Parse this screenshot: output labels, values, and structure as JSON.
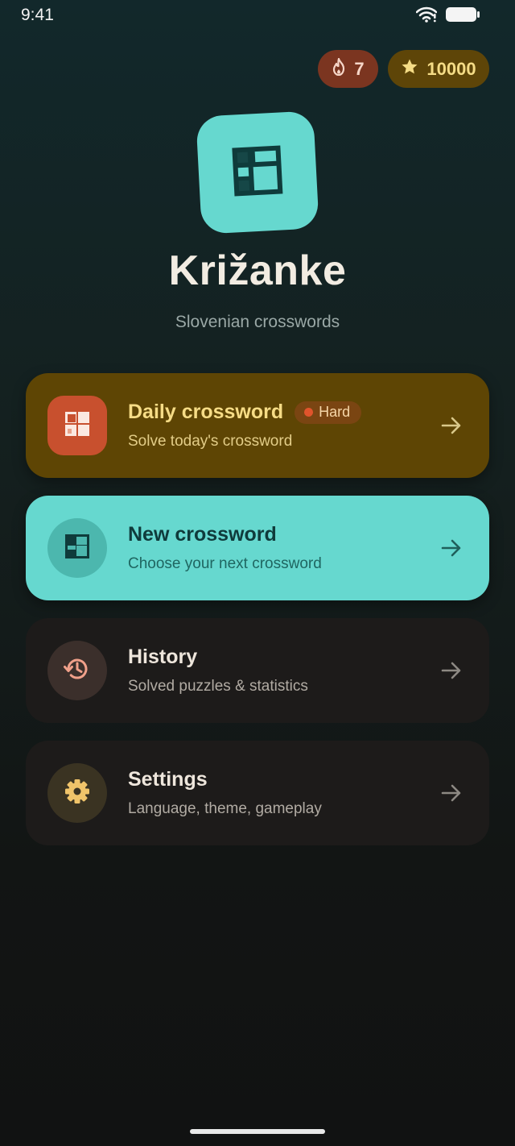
{
  "status_bar": {
    "time": "9:41"
  },
  "stats": {
    "streak": "7",
    "stars": "10000"
  },
  "app": {
    "title": "Križanke",
    "subtitle": "Slovenian crosswords"
  },
  "menu": {
    "daily": {
      "title": "Daily crossword",
      "badge": "Hard",
      "subtitle": "Solve today's crossword"
    },
    "new": {
      "title": "New crossword",
      "subtitle": "Choose your next crossword"
    },
    "history": {
      "title": "History",
      "subtitle": "Solved puzzles & statistics"
    },
    "settings": {
      "title": "Settings",
      "subtitle": "Language, theme, gameplay"
    }
  },
  "icons": {
    "streak": "flame-icon",
    "stars": "star-icon",
    "app": "crossword-grid-icon",
    "daily": "crossword-grid-icon",
    "new": "crossword-grid-icon",
    "history": "history-icon",
    "settings": "gear-icon",
    "arrow": "arrow-right-icon"
  },
  "colors": {
    "accent_teal": "#66d8cf",
    "daily_card": "#5e4504",
    "daily_icon": "#c8502e",
    "streak_pill": "#7b3520",
    "stars_pill": "#5e4508",
    "difficulty_hard": "#e0542c"
  }
}
